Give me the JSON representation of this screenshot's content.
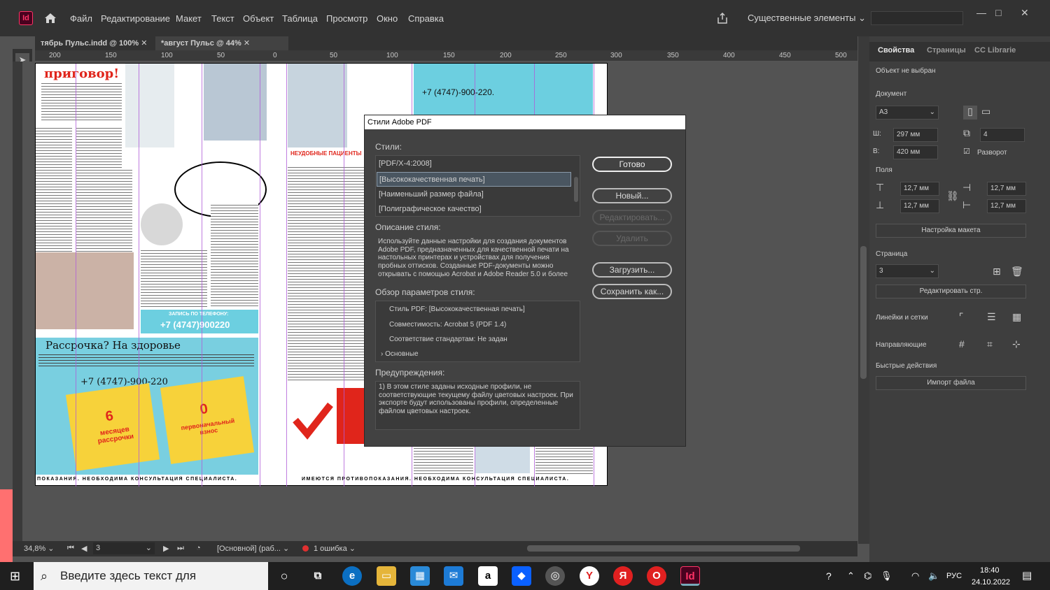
{
  "app": {
    "icon_label": "Id"
  },
  "menu": [
    "Файл",
    "Редактирование",
    "Макет",
    "Текст",
    "Объект",
    "Таблица",
    "Просмотр",
    "Окно",
    "Справка"
  ],
  "workspace": "Существенные элементы",
  "tabs": [
    "тябрь Пульс.indd @ 100%",
    "*август Пульс @ 44%"
  ],
  "ruler_labels": [
    "200",
    "150",
    "100",
    "50",
    "0",
    "50",
    "100",
    "150",
    "200",
    "250",
    "300",
    "350",
    "400",
    "450",
    "500"
  ],
  "page_text": {
    "headline": "приговор!",
    "ad_heading": "Рассрочка? На здоровье",
    "phone": "+7 (4747)-900-220",
    "phone_box": "+7 (4747)900220",
    "phone_label": "ЗАПИСЬ ПО ТЕЛЕФОНУ:",
    "top_phone": "+7 (4747)-900-220.",
    "sticker1_num": "6",
    "sticker1_text": "месяцев рассрочки",
    "sticker2_num": "0",
    "sticker2_text": "первоначальный взнос",
    "bottom_strip_left": "ПОКАЗАНИЯ. НЕОБХОДИМА КОНСУЛЬТАЦИЯ СПЕЦИАЛИСТА.",
    "bottom_strip_right": "ИМЕЮТСЯ ПРОТИВОПОКАЗАНИЯ. НЕОБХОДИМА КОНСУЛЬТАЦИЯ СПЕЦИАЛИСТА.",
    "red_box": "НЕУДОБНЫЕ ПАЦИЕНТЫ"
  },
  "dialog": {
    "title": "Стили Adobe PDF",
    "styles_label": "Стили:",
    "styles": [
      "[PDF/X-4:2008]",
      "[Высококачественная печать]",
      "[Наименьший размер файла]",
      "[Полиграфическое качество]"
    ],
    "selected_index": 1,
    "desc_label": "Описание стиля:",
    "description": "Используйте данные настройки для создания документов Adobe PDF, предназначенных для качественной печати на настольных принтерах и устройствах для получения пробных оттисков.  Созданные PDF-документы можно открывать с помощью Acrobat и Adobe Reader 5.0 и более",
    "summary_label": "Обзор параметров стиля:",
    "summary": [
      "Стиль PDF: [Высококачественная печать]",
      "Совместимость: Acrobat 5 (PDF 1.4)",
      "Соответствие стандартам: Не задан",
      "Основные"
    ],
    "warnings_label": "Предупреждения:",
    "warnings": "1) В этом стиле заданы исходные профили, не соответствующие текущему файлу цветовых настроек. При экспорте будут использованы профили, определенные файлом цветовых настроек.",
    "buttons": {
      "done": "Готово",
      "new": "Новый...",
      "edit": "Редактировать...",
      "delete": "Удалить",
      "load": "Загрузить...",
      "save_as": "Сохранить как..."
    }
  },
  "panel": {
    "tabs": [
      "Свойства",
      "Страницы",
      "CC Librarie"
    ],
    "no_selection": "Объект не выбран",
    "document_label": "Документ",
    "page_size": "А3",
    "width_label": "Ш:",
    "width": "297 мм",
    "height_label": "В:",
    "height": "420 мм",
    "pages_count": "4",
    "spread_label": "Разворот",
    "margins_label": "Поля",
    "margin_top": "12,7 мм",
    "margin_bottom": "12,7 мм",
    "margin_right": "12,7 мм",
    "margin_left": "12,7 мм",
    "layout_btn": "Настройка макета",
    "page_label": "Страница",
    "page_value": "3",
    "edit_page_btn": "Редактировать стр.",
    "rulers_label": "Линейки и сетки",
    "guides_label": "Направляющие",
    "quick_label": "Быстрые действия",
    "import_btn": "Импорт файла"
  },
  "status": {
    "zoom": "34,8%",
    "page": "3",
    "style": "[Основной] (раб...",
    "errors": "1 ошибка"
  },
  "taskbar": {
    "search_placeholder": "Введите здесь текст для",
    "lang": "РУС",
    "time": "18:40",
    "date": "24.10.2022"
  }
}
